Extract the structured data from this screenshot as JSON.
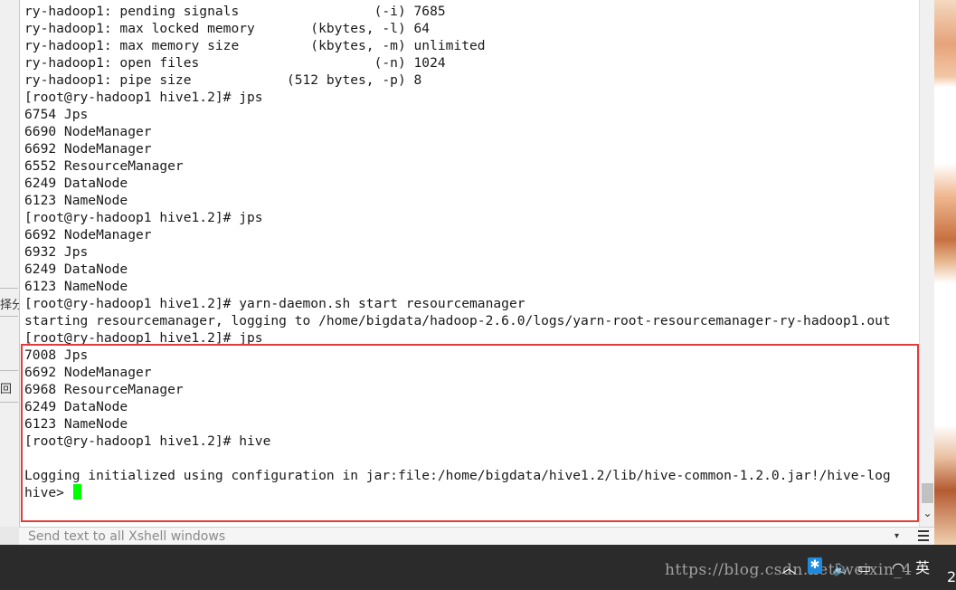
{
  "terminal": {
    "lines": [
      "ry-hadoop1: pending signals                 (-i) 7685",
      "ry-hadoop1: max locked memory       (kbytes, -l) 64",
      "ry-hadoop1: max memory size         (kbytes, -m) unlimited",
      "ry-hadoop1: open files                      (-n) 1024",
      "ry-hadoop1: pipe size            (512 bytes, -p) 8",
      "[root@ry-hadoop1 hive1.2]# jps",
      "6754 Jps",
      "6690 NodeManager",
      "6692 NodeManager",
      "6552 ResourceManager",
      "6249 DataNode",
      "6123 NameNode",
      "[root@ry-hadoop1 hive1.2]# jps",
      "6692 NodeManager",
      "6932 Jps",
      "6249 DataNode",
      "6123 NameNode",
      "[root@ry-hadoop1 hive1.2]# yarn-daemon.sh start resourcemanager",
      "starting resourcemanager, logging to /home/bigdata/hadoop-2.6.0/logs/yarn-root-resourcemanager-ry-hadoop1.out",
      "[root@ry-hadoop1 hive1.2]# jps",
      "7008 Jps",
      "6692 NodeManager",
      "6968 ResourceManager",
      "6249 DataNode",
      "6123 NameNode",
      "[root@ry-hadoop1 hive1.2]# hive",
      "",
      "Logging initialized using configuration in jar:file:/home/bigdata/hive1.2/lib/hive-common-1.2.0.jar!/hive-log",
      "hive> "
    ]
  },
  "left_window": {
    "fragment1": "择分",
    "fragment2": "回"
  },
  "send_bar": {
    "text": "Send text to all Xshell windows",
    "dropdown": "▾"
  },
  "taskbar": {
    "chevron": "︿",
    "volume": "🔈",
    "lang": "英",
    "clock_fragment": "2",
    "watermark": "https://blog.csdn.net/weixin_4"
  },
  "colors": {
    "highlight_border": "#e23c3c",
    "cursor": "#00ff00",
    "taskbar_bg": "#2b2b2b"
  }
}
